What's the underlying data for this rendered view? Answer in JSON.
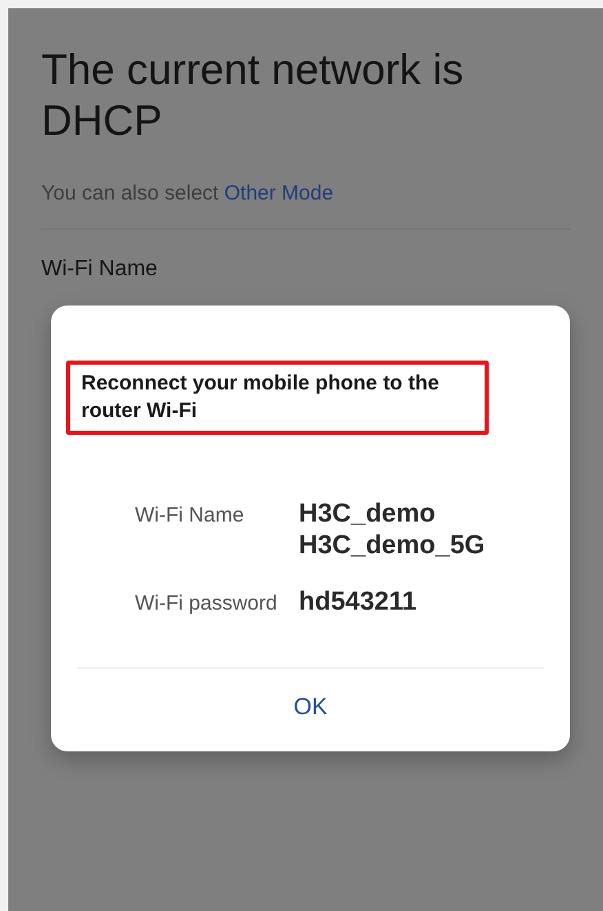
{
  "page": {
    "title": "The current network is DHCP",
    "subtitle": "You can also select",
    "subtitle_link": "Other Mode",
    "field_label": "Wi-Fi Name"
  },
  "dialog": {
    "title": "Reconnect your mobile phone to the router Wi-Fi",
    "highlighted": true,
    "rows": [
      {
        "label": "Wi-Fi Name",
        "values": [
          "H3C_demo",
          "H3C_demo_5G"
        ]
      },
      {
        "label": "Wi-Fi password",
        "values": [
          "hd543211"
        ]
      }
    ],
    "button": "OK"
  }
}
